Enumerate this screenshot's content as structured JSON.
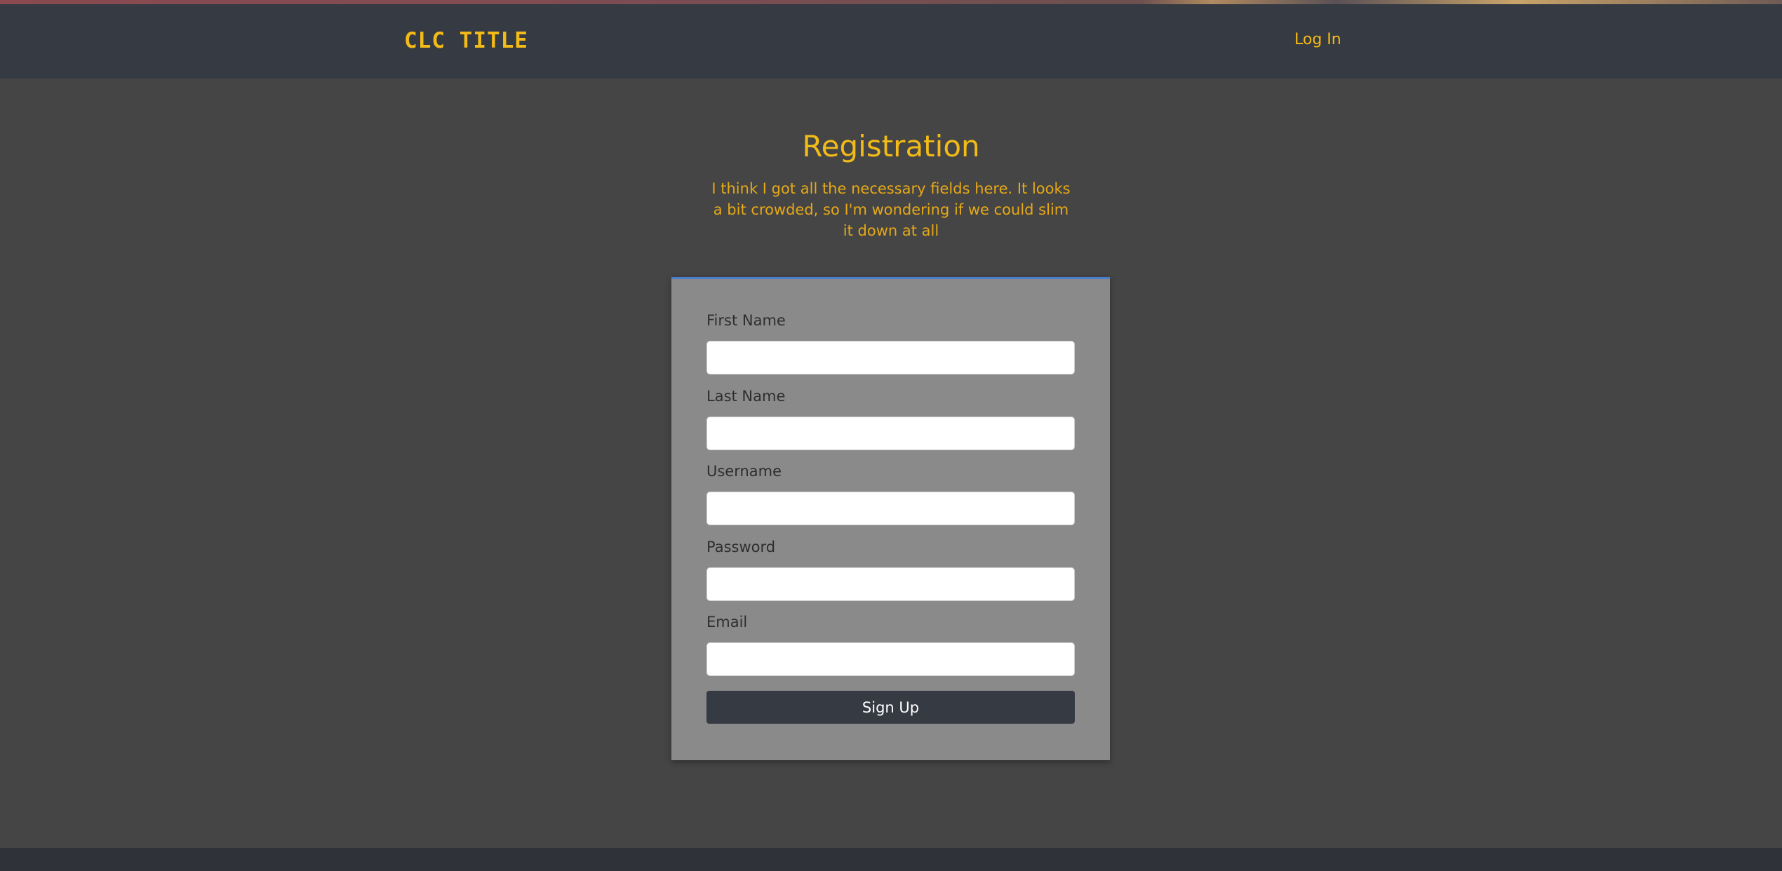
{
  "navbar": {
    "brand": "CLC TITLE",
    "login_label": "Log In"
  },
  "page": {
    "title": "Registration",
    "subtitle": "I think I got all the necessary fields here. It looks a bit crowded, so I'm wondering if we could slim it down at all"
  },
  "form": {
    "fields": [
      {
        "label": "First Name",
        "value": ""
      },
      {
        "label": "Last Name",
        "value": ""
      },
      {
        "label": "Username",
        "value": ""
      },
      {
        "label": "Password",
        "value": ""
      },
      {
        "label": "Email",
        "value": ""
      }
    ],
    "submit_label": "Sign Up"
  },
  "colors": {
    "accent": "#f2bb17",
    "navbar": "#363a42",
    "background": "#454545",
    "card": "#8a8a8a",
    "card_top_border": "#4a7fd0"
  }
}
